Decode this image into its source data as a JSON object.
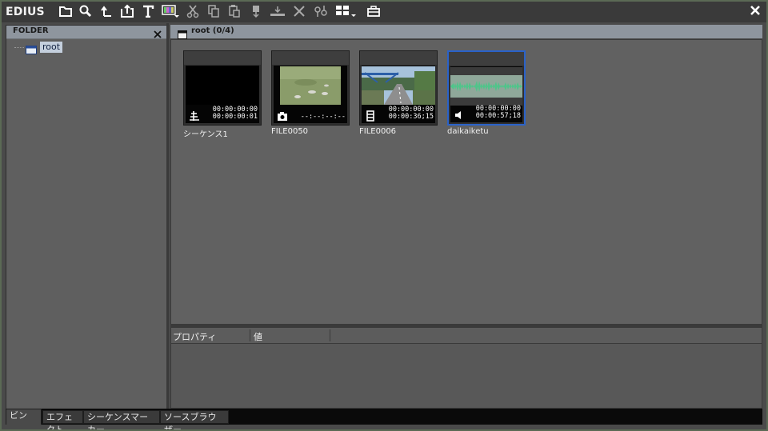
{
  "app": {
    "title": "EDIUS"
  },
  "toolbar": {
    "buttons": [
      "new-folder-icon",
      "search-icon",
      "up-level-icon",
      "import-icon",
      "title-icon",
      "color-bar-icon",
      "cut-icon",
      "copy-icon",
      "paste-icon",
      "add-to-timeline-icon",
      "insert-icon",
      "delete-icon",
      "properties-icon",
      "view-mode-icon",
      "toolbox-icon"
    ]
  },
  "folder_panel": {
    "title": "FOLDER",
    "root_label": "root"
  },
  "bin": {
    "title": "root (0/4)",
    "clips": [
      {
        "name": "シーケンス1",
        "tc_in": "00:00:00:00",
        "tc_out": "00:00:00:01",
        "type": "sequence-icon",
        "thumb": "black",
        "selected": false
      },
      {
        "name": "FILE0050",
        "tc_in": "",
        "tc_out": "--:--:--:--",
        "type": "still-image-icon",
        "thumb": "ducks",
        "selected": false
      },
      {
        "name": "FILE0006",
        "tc_in": "00:00:00:00",
        "tc_out": "00:00:36;15",
        "type": "video-clip-icon",
        "thumb": "road",
        "selected": false
      },
      {
        "name": "daikaiketu",
        "tc_in": "00:00:00:00",
        "tc_out": "00:00:57;18",
        "type": "audio-clip-icon",
        "thumb": "waveform",
        "selected": true
      }
    ]
  },
  "properties": {
    "col_property": "プロパティ",
    "col_value": "値"
  },
  "tabs": [
    {
      "label": "ビン",
      "active": true
    },
    {
      "label": "エフェクト",
      "active": false
    },
    {
      "label": "シーケンスマーカー",
      "active": false
    },
    {
      "label": "ソースブラウザー",
      "active": false
    }
  ],
  "colors": {
    "selection": "#2a62c9",
    "header": "#8e959e",
    "waveform": "#4fc58a"
  }
}
